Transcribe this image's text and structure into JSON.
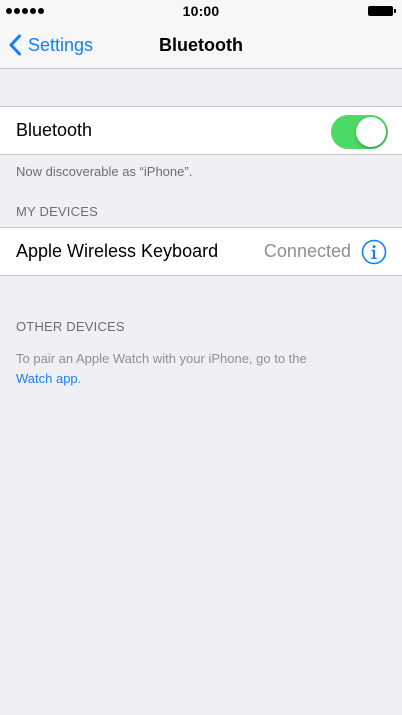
{
  "status_bar": {
    "time": "10:00"
  },
  "nav": {
    "back_label": "Settings",
    "title": "Bluetooth"
  },
  "bluetooth_row": {
    "label": "Bluetooth",
    "toggle_on": true
  },
  "discoverable_text": "Now discoverable as “iPhone”.",
  "my_devices": {
    "header": "MY DEVICES",
    "devices": [
      {
        "name": "Apple Wireless Keyboard",
        "status": "Connected"
      }
    ]
  },
  "other_devices": {
    "header": "OTHER DEVICES",
    "help_text": "To pair an Apple Watch with your iPhone, go to the",
    "link_text": "Watch app",
    "help_suffix": "."
  },
  "colors": {
    "accent": "#157efb",
    "toggle_on": "#4cd964",
    "background": "#efeff4",
    "secondary_text": "#6d6d72"
  },
  "icons": {
    "back": "chevron-left-icon",
    "info": "info-circle-icon"
  }
}
